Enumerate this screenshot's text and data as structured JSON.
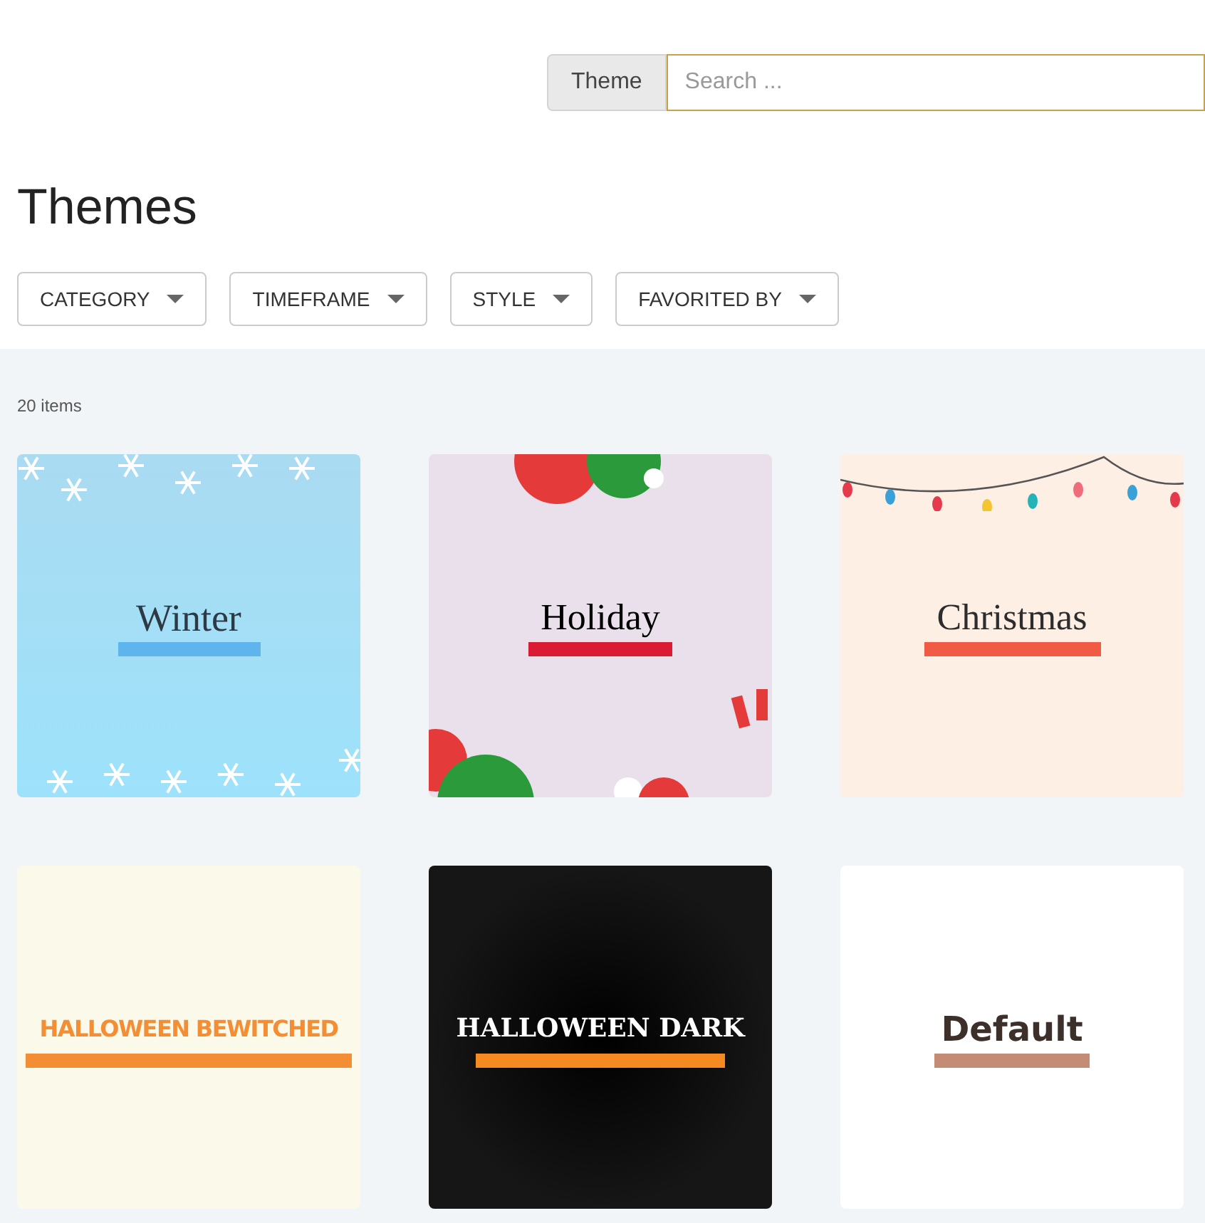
{
  "search": {
    "label": "Theme",
    "placeholder": "Search ..."
  },
  "heading": "Themes",
  "filters": [
    {
      "label": "CATEGORY"
    },
    {
      "label": "TIMEFRAME"
    },
    {
      "label": "STYLE"
    },
    {
      "label": "FAVORITED BY"
    }
  ],
  "count": "20 items",
  "themes": [
    {
      "name": "Winter",
      "kind": "winter",
      "color": "#5eb4ec"
    },
    {
      "name": "Holiday",
      "kind": "holiday",
      "color": "#d91c34"
    },
    {
      "name": "Christmas",
      "kind": "christmas",
      "color": "#f15a45"
    },
    {
      "name": "HALLOWEEN BEWITCHED",
      "kind": "bewitched",
      "color": "#f38e34"
    },
    {
      "name": "HALLOWEEN DARK",
      "kind": "dark",
      "color": "#f68a22"
    },
    {
      "name": "Default",
      "kind": "default",
      "color": "#c48c74"
    }
  ]
}
